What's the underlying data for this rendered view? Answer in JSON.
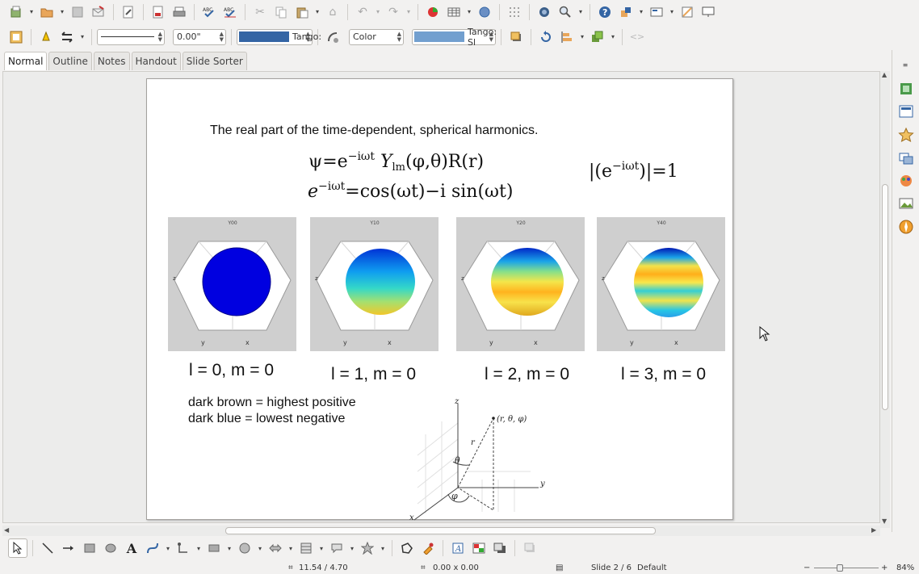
{
  "toolbar": {
    "line_style": "",
    "line_width": "0.00\"",
    "line_color_name": "Tango:",
    "line_color": "#3465a4",
    "area_style": "Color",
    "area_color_name": "Tango: Sl",
    "area_color": "#729fcf"
  },
  "view_tabs": [
    "Normal",
    "Outline",
    "Notes",
    "Handout",
    "Slide Sorter"
  ],
  "slide": {
    "title": "The real part of the time-dependent, spherical harmonics.",
    "eq1_lhs": "ψ=e",
    "eq1_exp": "−iωt",
    "eq1_y": "Y",
    "eq1_sub": "lm",
    "eq1_rest": "(φ,θ)R(r)",
    "eq2_lhs": "e",
    "eq2_exp": "−iωt",
    "eq2_rest": "=cos(ωt)−i sin(ωt)",
    "eq3_open": "|(e",
    "eq3_exp": "−iωt",
    "eq3_close": ")|=1",
    "panels": [
      {
        "title": "Y00",
        "label": "l = 0, m = 0"
      },
      {
        "title": "Y10",
        "label": "l = 1, m = 0"
      },
      {
        "title": "Y20",
        "label": "l = 2, m = 0"
      },
      {
        "title": "Y40",
        "label": "l = 3, m = 0"
      }
    ],
    "legend_line1": "dark brown = highest positive",
    "legend_line2": "dark blue = lowest negative",
    "diagram": {
      "z_label": "z",
      "y_label": "y",
      "x_label": "x",
      "r_label": "r",
      "theta_label": "θ",
      "phi_label": "φ",
      "point_label": "(r, θ, φ)"
    }
  },
  "status": {
    "position": "11.54 / 4.70",
    "size": "0.00 x 0.00",
    "slide": "Slide 2 / 6",
    "master": "Default",
    "zoom_minus": "−",
    "zoom_plus": "+",
    "zoom": "84%"
  }
}
